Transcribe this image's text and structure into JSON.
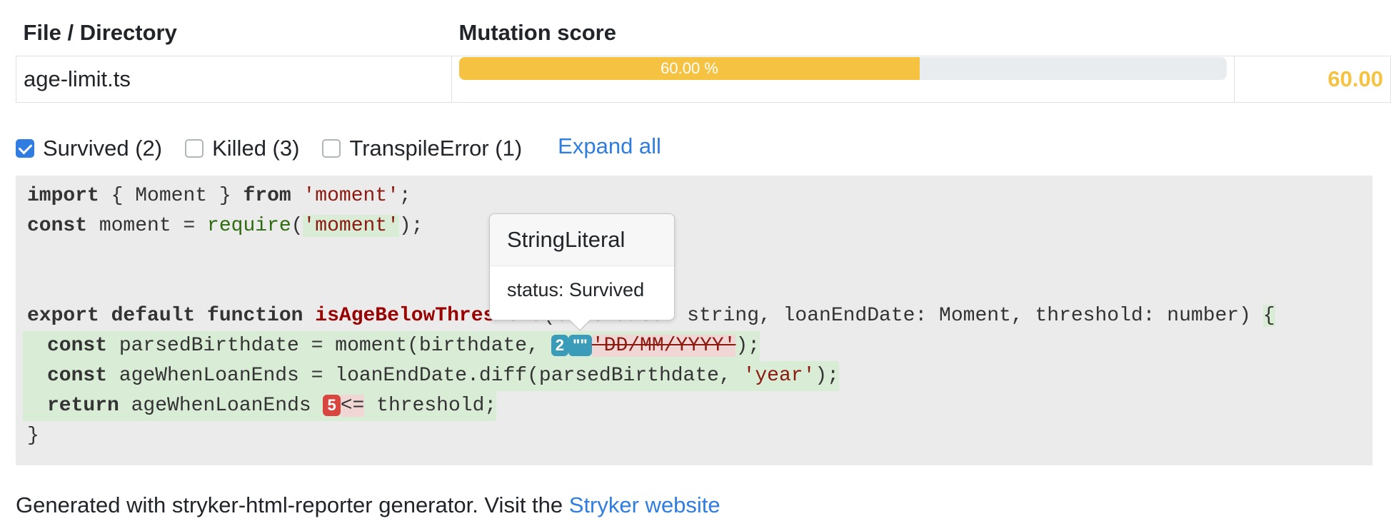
{
  "table": {
    "header_file": "File / Directory",
    "header_score": "Mutation score",
    "row": {
      "file": "age-limit.ts",
      "progress_label": "60.00 %",
      "progress_fraction": 0.6,
      "score": "60.00"
    }
  },
  "filters": {
    "survived": {
      "label": "Survived (2)",
      "checked": true
    },
    "killed": {
      "label": "Killed (3)",
      "checked": false
    },
    "transpile": {
      "label": "TranspileError (1)",
      "checked": false
    },
    "expand_all": "Expand all"
  },
  "code": {
    "l1": {
      "kw1": "import",
      "t1": " { Moment } ",
      "kw2": "from",
      "t2": " ",
      "str": "'moment'",
      "t3": ";"
    },
    "l2": {
      "kw1": "const",
      "t1": " moment = ",
      "call": "require",
      "t2": "(",
      "str": "'moment'",
      "t3": ");"
    },
    "l3": {
      "kw1": "export default function",
      "t1": " ",
      "fn": "isAgeBelowThreshold",
      "t2": "(birthdate: string, loanEndDate: Moment, threshold: number) ",
      "t3": "{"
    },
    "l4": {
      "kw1": "const",
      "t1": " parsedBirthdate = moment(birthdate, ",
      "badge": "2",
      "mutant": "\"\"",
      "str": "'DD/MM/YYYY'",
      "t2": ");"
    },
    "l5": {
      "kw1": "const",
      "t1": " ageWhenLoanEnds = loanEndDate.diff(parsedBirthdate, ",
      "str": "'year'",
      "t2": ");"
    },
    "l6": {
      "kw1": "return",
      "t1": " ageWhenLoanEnds ",
      "badge": "5",
      "op": "<=",
      "t2": " threshold;"
    },
    "l7": {
      "t1": "}"
    }
  },
  "popover": {
    "title": "StringLiteral",
    "body": "status: Survived"
  },
  "footer": {
    "text": "Generated with stryker-html-reporter generator. Visit the ",
    "link": "Stryker website"
  },
  "colors": {
    "progress": "#f5c242",
    "link": "#2f7de1",
    "survived_badge": "#3a9cb8",
    "killed_badge": "#d9453f"
  }
}
